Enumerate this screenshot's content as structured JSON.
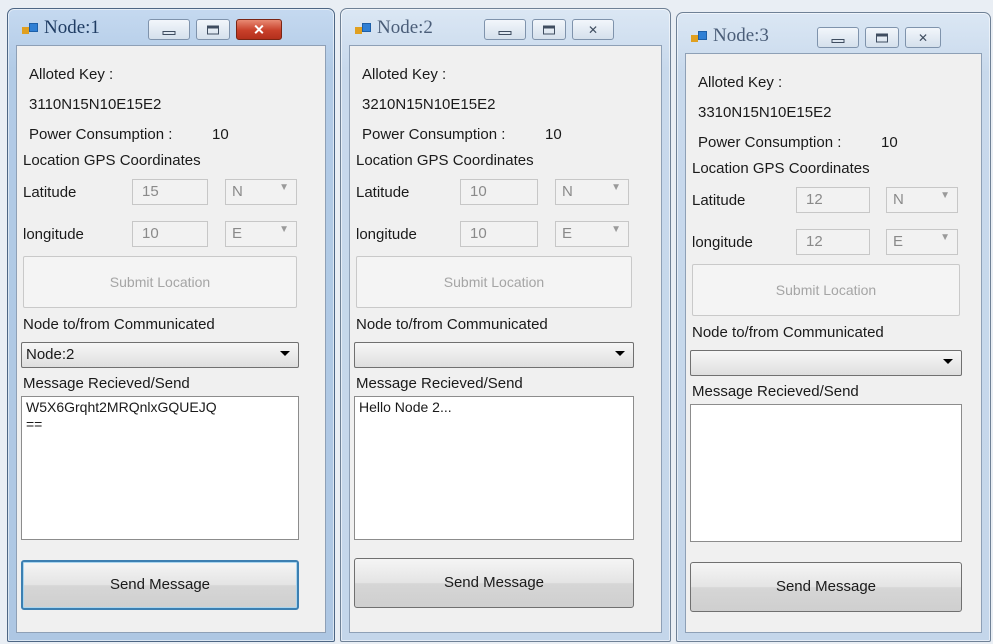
{
  "windows": [
    {
      "title": "Node:1",
      "alloted_key_label": "Alloted Key :",
      "alloted_key": "3110N15N10E15E2",
      "power_label": "Power Consumption :",
      "power_value": "10",
      "gps_label": "Location GPS Coordinates",
      "latitude_label": "Latitude",
      "latitude_value": "15",
      "latitude_dir": "N",
      "longitude_label": "longitude",
      "longitude_value": "10",
      "longitude_dir": "E",
      "submit_label": "Submit Location",
      "comm_label": "Node to/from Communicated",
      "comm_selected": "Node:2",
      "message_label": "Message Recieved/Send",
      "message_text": "W5X6Grqht2MRQnlxGQUEJQ\n==",
      "send_label": "Send Message"
    },
    {
      "title": "Node:2",
      "alloted_key_label": "Alloted Key :",
      "alloted_key": "3210N15N10E15E2",
      "power_label": "Power Consumption :",
      "power_value": "10",
      "gps_label": "Location GPS Coordinates",
      "latitude_label": "Latitude",
      "latitude_value": "10",
      "latitude_dir": "N",
      "longitude_label": "longitude",
      "longitude_value": "10",
      "longitude_dir": "E",
      "submit_label": "Submit Location",
      "comm_label": "Node to/from Communicated",
      "comm_selected": "",
      "message_label": "Message Recieved/Send",
      "message_text": "Hello Node 2...",
      "send_label": "Send Message"
    },
    {
      "title": "Node:3",
      "alloted_key_label": "Alloted Key :",
      "alloted_key": "3310N15N10E15E2",
      "power_label": "Power Consumption :",
      "power_value": "10",
      "gps_label": "Location GPS Coordinates",
      "latitude_label": "Latitude",
      "latitude_value": "12",
      "latitude_dir": "N",
      "longitude_label": "longitude",
      "longitude_value": "12",
      "longitude_dir": "E",
      "submit_label": "Submit Location",
      "comm_label": "Node to/from Communicated",
      "comm_selected": "",
      "message_label": "Message Recieved/Send",
      "message_text": "",
      "send_label": "Send Message"
    }
  ],
  "icons": {
    "app": "form-icon",
    "minimize": "minimize-icon",
    "maximize": "maximize-icon",
    "close": "close-icon",
    "dropdown": "chevron-down-icon"
  },
  "colors": {
    "active_close": "#c8402a",
    "focus_border": "#3c7fb1"
  }
}
